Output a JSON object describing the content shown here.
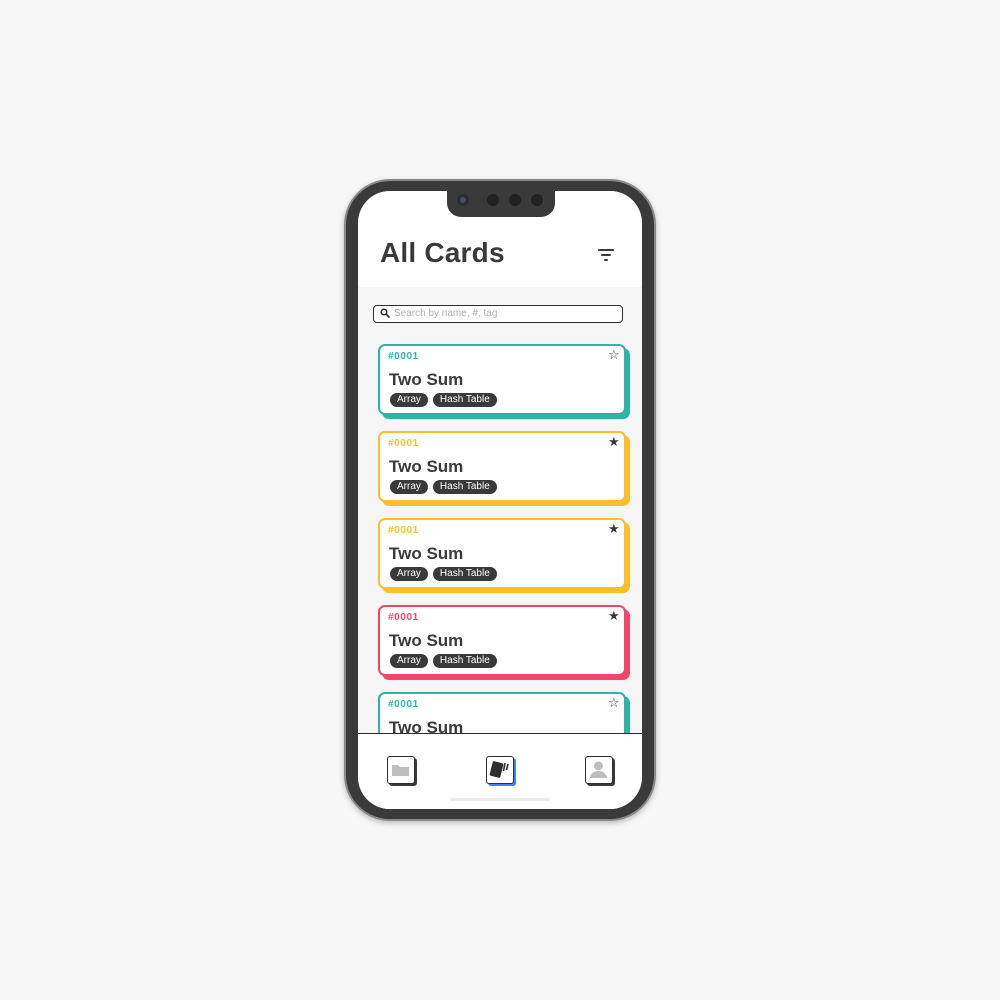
{
  "header": {
    "title": "All Cards"
  },
  "icons": {
    "filter": "filter-icon",
    "search": "search-icon",
    "star_outline": "star-outline-icon",
    "star_filled": "star-filled-icon",
    "folder": "folder-icon",
    "cards": "cards-icon",
    "profile": "profile-icon"
  },
  "search": {
    "value": "",
    "placeholder": "Search by name, #, tag"
  },
  "colors": {
    "teal": "#2ab5a5",
    "yellow": "#fcbf2a",
    "red": "#f2466b",
    "dark": "#3a3a3a",
    "active_nav": "#3b82f6"
  },
  "cards": [
    {
      "number": "#0001",
      "name": "Two Sum",
      "tags": [
        "Array",
        "Hash Table"
      ],
      "color": "#2ab5a5",
      "starred": false,
      "star": "☆"
    },
    {
      "number": "#0001",
      "name": "Two Sum",
      "tags": [
        "Array",
        "Hash Table"
      ],
      "color": "#fcbf2a",
      "starred": true,
      "star": "★"
    },
    {
      "number": "#0001",
      "name": "Two Sum",
      "tags": [
        "Array",
        "Hash Table"
      ],
      "color": "#fcbf2a",
      "starred": true,
      "star": "★"
    },
    {
      "number": "#0001",
      "name": "Two Sum",
      "tags": [
        "Array",
        "Hash Table"
      ],
      "color": "#f2466b",
      "starred": true,
      "star": "★"
    },
    {
      "number": "#0001",
      "name": "Two Sum",
      "tags": [],
      "color": "#2ab5a5",
      "starred": false,
      "star": "☆"
    }
  ],
  "bottom_nav": {
    "active": "cards"
  }
}
